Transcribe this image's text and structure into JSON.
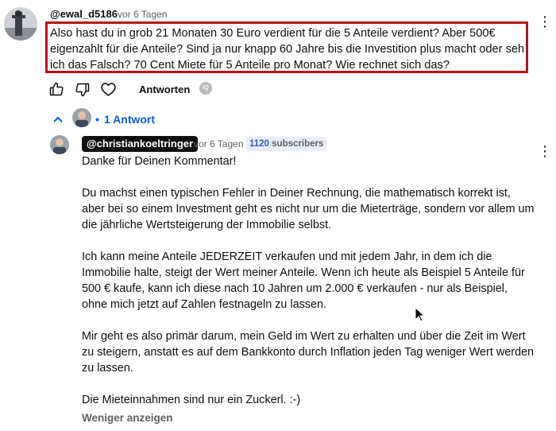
{
  "comment": {
    "author": "@ewal_d5186",
    "time": "vor 6 Tagen",
    "text": "Also hast du in grob 21 Monaten 30 Euro verdient für die 5 Anteile verdient? Aber 500€ eigenzahlt für die Anteile? Sind ja nur knapp 60 Jahre bis die Investition plus macht oder seh ich das Falsch? 70 Cent Miete für 5 Anteile pro Monat? Wie rechnet sich das?",
    "reply_label": "Antworten",
    "ai_badge": "IQ",
    "icons": [
      "like-icon",
      "dislike-icon",
      "heart-icon",
      "more-vert-icon"
    ]
  },
  "replies": {
    "toggle_label": "1 Antwort",
    "toggle_icon": "chevron-up-icon"
  },
  "reply": {
    "author": "@christiankoeltringer",
    "time": "vor 6 Tagen",
    "subscriber_count": "1120",
    "subscriber_label": "subscribers",
    "paragraphs": [
      "Danke für Deinen Kommentar!",
      "Du machst einen typischen Fehler in Deiner Rechnung, die mathematisch korrekt ist, aber bei so einem Investment geht es nicht nur um die Mieterträge, sondern vor allem um die jährliche Wertsteigerung der Immobilie selbst.",
      "Ich kann meine Anteile JEDERZEIT verkaufen und mit jedem Jahr, in dem ich die Immobilie halte, steigt der Wert meiner Anteile. Wenn ich heute als Beispiel 5 Anteile für 500 € kaufe, kann ich diese nach 10 Jahren um 2.000 € verkaufen - nur als Beispiel, ohne mich jetzt auf Zahlen festnageln zu lassen.",
      "Mir geht es also primär darum, mein Geld im Wert zu erhalten und über die Zeit im Wert zu steigern, anstatt es auf dem Bankkonto durch Inflation jeden Tag weniger Wert werden zu lassen.",
      "Die Mieteinnahmen sind nur ein Zuckerl. :-)"
    ],
    "show_less_label": "Weniger anzeigen"
  },
  "colors": {
    "highlight_border": "#b3121a",
    "link_blue": "#065fd4",
    "channel_chip_bg": "#0f0f0f"
  }
}
